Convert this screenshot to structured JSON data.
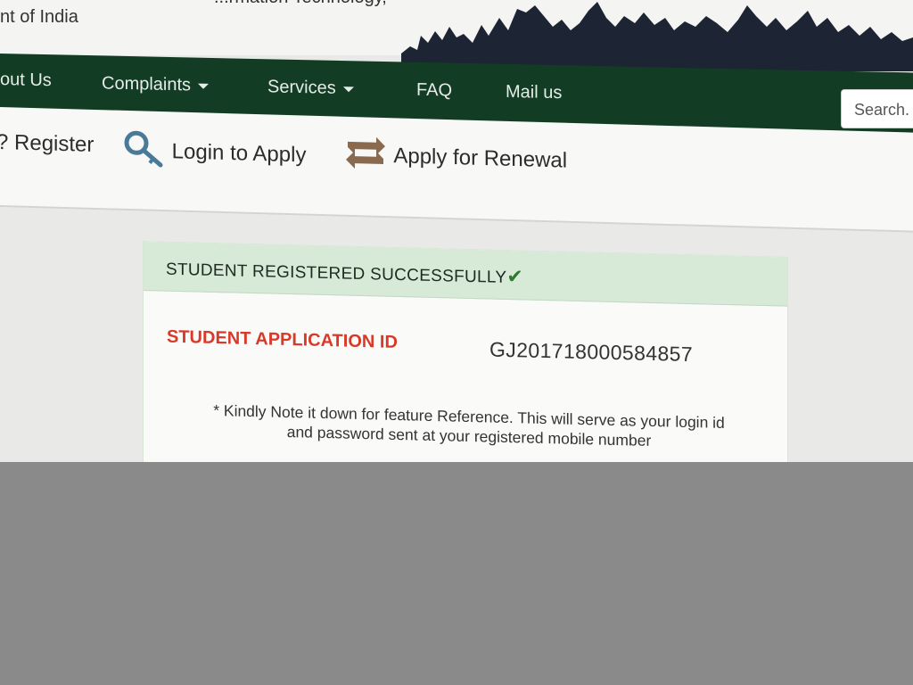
{
  "header": {
    "org_line_top": "...rmation Technology,",
    "org_line": "nt of India"
  },
  "nav": {
    "items": [
      {
        "label": "out Us"
      },
      {
        "label": "Complaints"
      },
      {
        "label": "Services"
      },
      {
        "label": "FAQ"
      },
      {
        "label": "Mail us"
      }
    ],
    "search_placeholder": "Search."
  },
  "toolbar": {
    "register_label": "? Register",
    "login_label": "Login to Apply",
    "renewal_label": "Apply for Renewal"
  },
  "card": {
    "title": "STUDENT REGISTERED SUCCESSFULLY",
    "check": "✔",
    "id_label": "STUDENT APPLICATION ID",
    "id_value": "GJ201718000584857",
    "note_line1": "* Kindly Note it down for feature Reference. This will serve as your login id",
    "note_line2": "and password sent at your registered mobile number"
  },
  "colors": {
    "nav_bg": "#123d24",
    "success_header": "#d7ead8",
    "id_label": "#d83a2a",
    "check": "#2f7a2f"
  }
}
